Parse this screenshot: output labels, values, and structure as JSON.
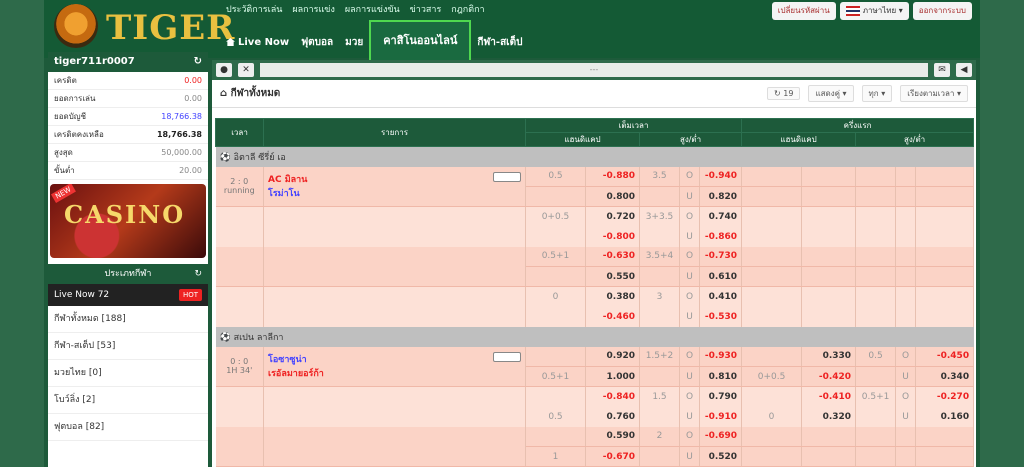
{
  "brand": {
    "logo_text": "TIGER"
  },
  "topnav": [
    "ประวัติการเล่น",
    "ผลการแข่ง",
    "ผลการแข่งขัน",
    "ข่าวสาร",
    "กฎกติกา"
  ],
  "top_right": {
    "history_btn": "เปลี่ยนรหัสผ่าน",
    "lang": "ภาษาไทย",
    "logout": "ออกจากระบบ"
  },
  "mainnav": {
    "live": "Live Now",
    "football": "ฟุตบอล",
    "other": "มวย",
    "casino": "คาสิโนออนไลน์",
    "sports": "กีฬา-สเต็ป"
  },
  "account": {
    "username": "tiger711r0007",
    "rows": [
      {
        "label": "เครดิต",
        "value": "0.00",
        "tone": "red"
      },
      {
        "label": "ยอดการเล่น",
        "value": "0.00",
        "tone": "v"
      },
      {
        "label": "ยอดบัญชี",
        "value": "18,766.38",
        "tone": "blue"
      },
      {
        "label": "เครดิตคงเหลือ",
        "value": "18,766.38",
        "tone": "dark"
      },
      {
        "label": "สูงสุด",
        "value": "50,000.00",
        "tone": "v"
      },
      {
        "label": "ขั้นต่ำ",
        "value": "20.00",
        "tone": "v"
      }
    ]
  },
  "banner": {
    "text": "CASINO",
    "tag": "NEW"
  },
  "sports_menu": {
    "title": "ประเภทกีฬา",
    "live_label": "Live Now 72",
    "hot": "HOT",
    "items": [
      "กีฬาทั้งหมด [188]",
      "กีฬา-สเต็ป [53]",
      "มวยไทย [0]",
      "โบว์ลิ่ง [2]",
      "ฟุตบอล [82]"
    ]
  },
  "toolbar": {
    "ticker": "---"
  },
  "page": {
    "title": "กีฬาทั้งหมด",
    "refresh_count": "19",
    "filter1": "แสดงคู่",
    "filter2": "ทุก",
    "filter3": "เรียงตามเวลา"
  },
  "table": {
    "col_time": "เวลา",
    "col_event": "รายการ",
    "col_ft": "เต็มเวลา",
    "col_ht": "ครึ่งแรก",
    "sub_hdp": "แฮนดิแคป",
    "sub_ou": "สูง/ต่ำ",
    "league1": "อิตาลี ซีรี่ย์ เอ",
    "league2": "สเปน ลาลีกา",
    "m1": {
      "score": "2 : 0",
      "status": "running",
      "team_a": "AC มิลาน",
      "team_b": "โรม่าโน"
    },
    "m2": {
      "score": "0 : 0",
      "status": "1H 34'",
      "team_a": "โอซาซูน่า",
      "team_b": "เรอัลมายอร์ก้า"
    }
  }
}
